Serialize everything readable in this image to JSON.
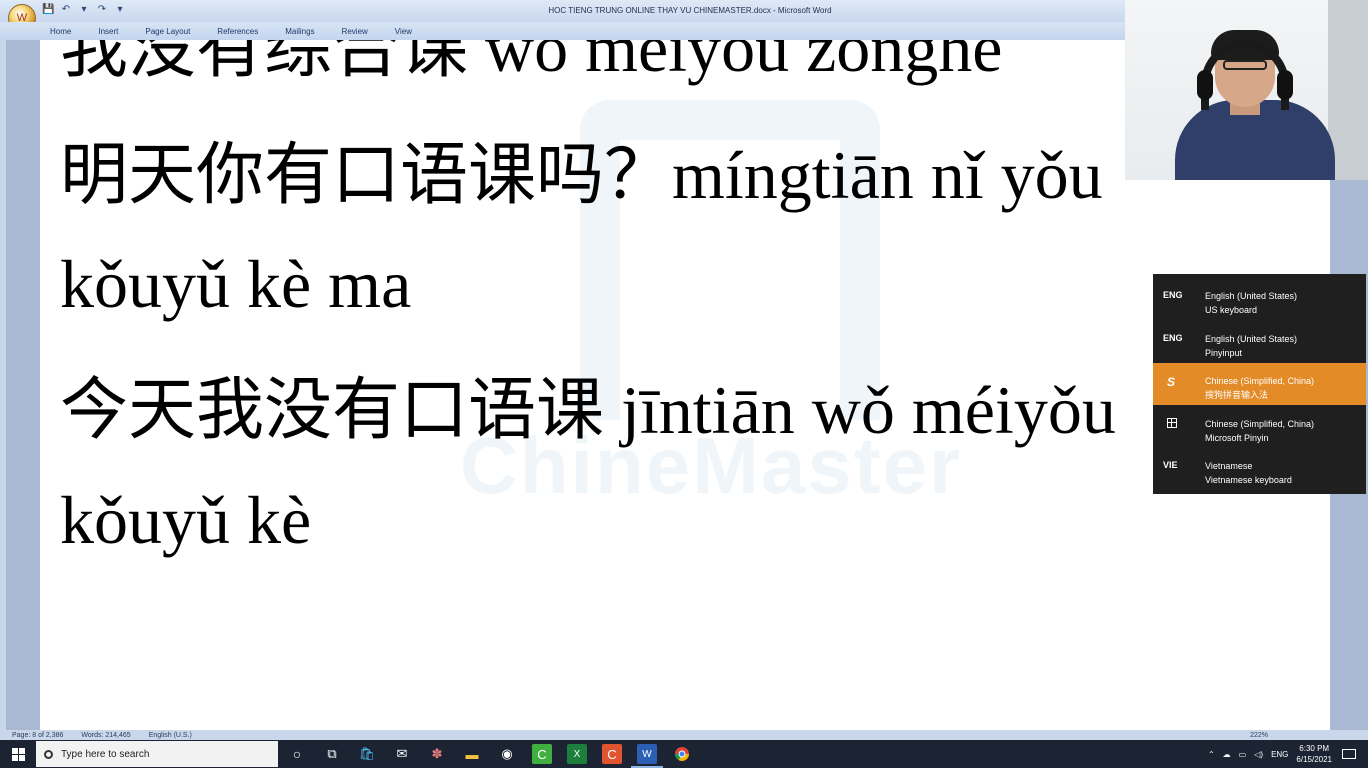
{
  "window": {
    "title": "HOC TIENG TRUNG ONLINE THAY VU CHINEMASTER.docx - Microsoft Word",
    "qat": [
      "💾",
      "↶",
      "▾",
      "↷",
      "▾"
    ]
  },
  "ribbon": {
    "tabs": [
      "Home",
      "Insert",
      "Page Layout",
      "References",
      "Mailings",
      "Review",
      "View"
    ]
  },
  "document": {
    "lines": [
      "我没有综合课 wǒ méiyǒu zōnghé",
      "明天你有口语课吗？míngtiān nǐ yǒu",
      "kǒuyǔ kè ma",
      "今天我没有口语课 jīntiān wǒ méiyǒu",
      "kǒuyǔ kè"
    ],
    "watermark": "ChineMaster"
  },
  "statusbar": {
    "page": "Page: 8 of 2,386",
    "words": "Words: 214,465",
    "language": "English (U.S.)",
    "zoom": "222%"
  },
  "language_menu": [
    {
      "code": "ENG",
      "name": "English (United States)",
      "layout": "US keyboard",
      "active": false
    },
    {
      "code": "ENG",
      "name": "English (United States)",
      "layout": "Pinyinput",
      "active": false
    },
    {
      "code": "S",
      "name": "Chinese (Simplified, China)",
      "layout": "搜狗拼音输入法",
      "active": true
    },
    {
      "code": "田",
      "name": "Chinese (Simplified, China)",
      "layout": "Microsoft Pinyin",
      "active": false
    },
    {
      "code": "VIE",
      "name": "Vietnamese",
      "layout": "Vietnamese keyboard",
      "active": false
    }
  ],
  "taskbar": {
    "search_placeholder": "Type here to search",
    "input_indicator": "ENG",
    "time": "6:30 PM",
    "date": "6/15/2021"
  }
}
